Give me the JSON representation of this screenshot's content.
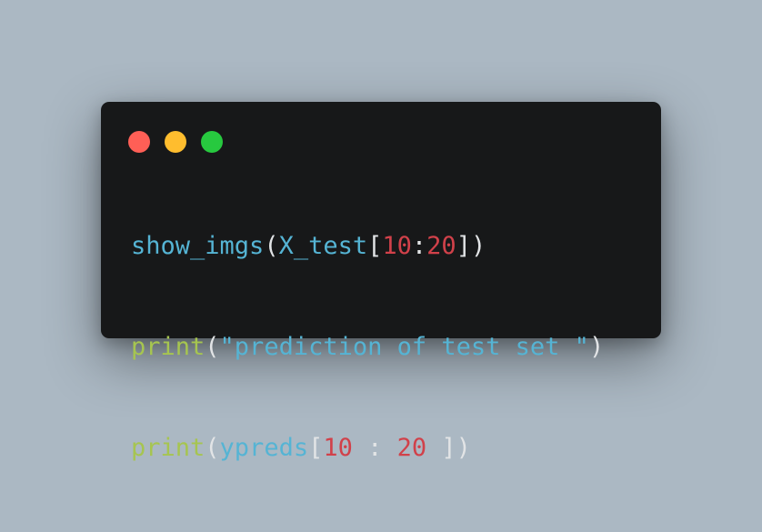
{
  "window": {
    "background_color": "#171819",
    "page_background_color": "#abb8c3",
    "controls": [
      {
        "name": "close",
        "color": "#ff5f56"
      },
      {
        "name": "minimize",
        "color": "#ffbd2e"
      },
      {
        "name": "maximize",
        "color": "#27c93f"
      }
    ]
  },
  "colors": {
    "function": "#55b4d4",
    "builtin": "#a6c550",
    "paren": "#e2e4e6",
    "number": "#d1414a",
    "string": "#55b4d4"
  },
  "code": {
    "lines": [
      [
        {
          "text": "show_imgs",
          "kind": "function"
        },
        {
          "text": "(",
          "kind": "paren"
        },
        {
          "text": "X_test",
          "kind": "function"
        },
        {
          "text": "[",
          "kind": "paren"
        },
        {
          "text": "10",
          "kind": "number"
        },
        {
          "text": ":",
          "kind": "paren"
        },
        {
          "text": "20",
          "kind": "number"
        },
        {
          "text": "])",
          "kind": "paren"
        }
      ],
      [
        {
          "text": "print",
          "kind": "builtin"
        },
        {
          "text": "(",
          "kind": "paren"
        },
        {
          "text": "\"prediction of test set \"",
          "kind": "string"
        },
        {
          "text": ")",
          "kind": "paren"
        }
      ],
      [
        {
          "text": "print",
          "kind": "builtin"
        },
        {
          "text": "(",
          "kind": "paren"
        },
        {
          "text": "ypreds",
          "kind": "function"
        },
        {
          "text": "[",
          "kind": "paren"
        },
        {
          "text": "10",
          "kind": "number"
        },
        {
          "text": " : ",
          "kind": "paren"
        },
        {
          "text": "20",
          "kind": "number"
        },
        {
          "text": " ])",
          "kind": "paren"
        }
      ]
    ]
  }
}
